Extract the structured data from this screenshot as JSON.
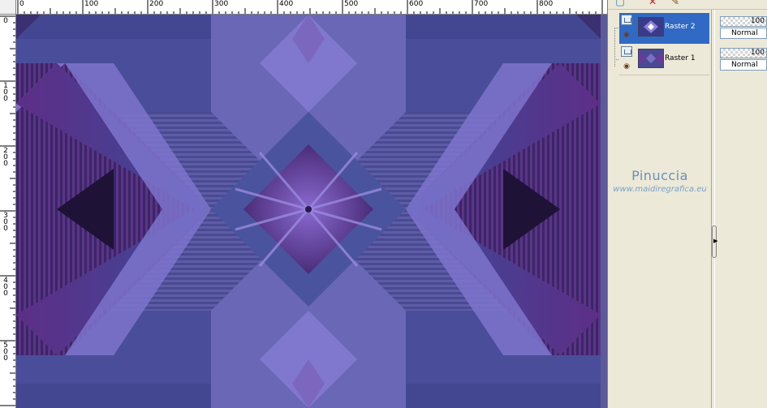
{
  "ruler": {
    "h_labels": [
      "0",
      "100",
      "200",
      "300",
      "400",
      "500",
      "600",
      "700",
      "800"
    ],
    "v_labels": [
      "0",
      "100",
      "200",
      "300",
      "400",
      "500"
    ]
  },
  "canvas": {
    "colors": {
      "background": "#5a5aa0",
      "lavender": "#8b7fd8",
      "purple": "#5a2d82",
      "dark": "#2a1a4a",
      "blue": "#4650a0"
    }
  },
  "layers_palette": {
    "toolbar_icons": [
      "new-layer-icon",
      "delete-layer-icon",
      "brush-icon"
    ],
    "layers": [
      {
        "name": "Raster 2",
        "opacity": "100",
        "blend_mode": "Normal",
        "selected": true
      },
      {
        "name": "Raster 1",
        "opacity": "100",
        "blend_mode": "Normal",
        "selected": false
      }
    ]
  },
  "watermark": {
    "name": "Pinuccia",
    "site": "www.maidiregrafica.eu"
  }
}
